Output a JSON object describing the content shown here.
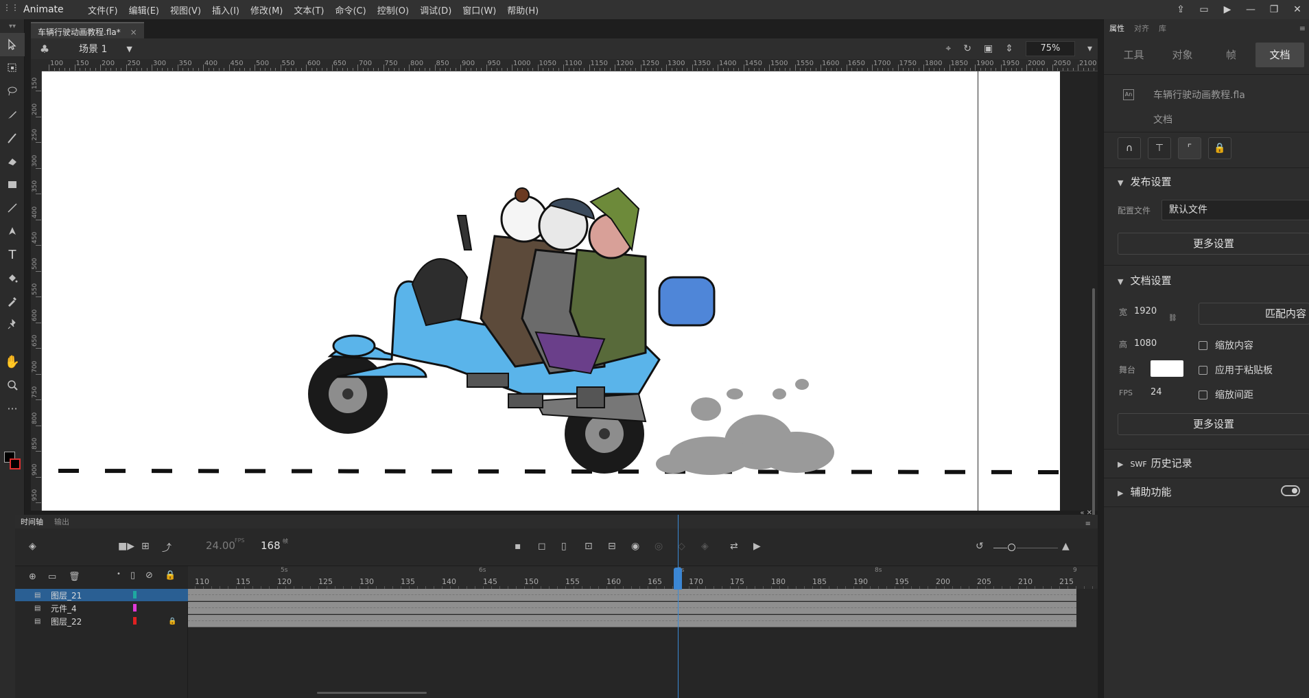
{
  "menubar": {
    "app_name": "Animate",
    "items": [
      "文件(F)",
      "编辑(E)",
      "视图(V)",
      "插入(I)",
      "修改(M)",
      "文本(T)",
      "命令(C)",
      "控制(O)",
      "调试(D)",
      "窗口(W)",
      "帮助(H)"
    ]
  },
  "document": {
    "tab_title": "车辆行驶动画教程.fla*",
    "close_glyph": "×"
  },
  "scene": {
    "label": "场景 1",
    "zoom": "75%"
  },
  "ruler": {
    "h_labels": [
      "100",
      "150",
      "200",
      "250",
      "300",
      "350",
      "400",
      "450",
      "500",
      "550",
      "600",
      "650",
      "700",
      "750",
      "800",
      "850",
      "900",
      "950",
      "1000",
      "1050",
      "1100",
      "1150",
      "1200",
      "1250",
      "1300",
      "1350",
      "1400",
      "1450",
      "1500",
      "1550",
      "1600",
      "1650",
      "1700",
      "1750",
      "1800",
      "1850",
      "1900",
      "1950",
      "2000",
      "2050",
      "2100"
    ],
    "v_labels": [
      "150",
      "200",
      "250",
      "300",
      "350",
      "400",
      "450",
      "500",
      "550",
      "600",
      "650",
      "700",
      "750",
      "800",
      "850",
      "900",
      "950"
    ]
  },
  "timeline": {
    "tabs": [
      "时间轴",
      "输出"
    ],
    "fps": "24.00",
    "fps_unit": "FPS",
    "frame": "168",
    "frame_unit": "帧",
    "sec_labels": [
      "5s",
      "6s",
      "7s",
      "8s",
      "9"
    ],
    "frame_numbers": [
      "110",
      "115",
      "120",
      "125",
      "130",
      "135",
      "140",
      "145",
      "150",
      "155",
      "160",
      "165",
      "170",
      "175",
      "180",
      "185",
      "190",
      "195",
      "200",
      "205",
      "210",
      "215"
    ],
    "layers": [
      {
        "name": "图层_21",
        "color": "#1fa8a0",
        "selected": true,
        "locked": false
      },
      {
        "name": "元件_4",
        "color": "#e03ad8",
        "selected": false,
        "locked": false
      },
      {
        "name": "图层_22",
        "color": "#e02020",
        "selected": false,
        "locked": true
      }
    ]
  },
  "properties": {
    "top_tabs": [
      "属性",
      "对齐",
      "库"
    ],
    "sub_tabs": [
      "工具",
      "对象",
      "帧",
      "文档"
    ],
    "doc_name": "车辆行驶动画教程.fla",
    "doc_type": "文档",
    "publish": {
      "title": "发布设置",
      "profile_label": "配置文件",
      "profile_value": "默认文件",
      "more_settings": "更多设置"
    },
    "doc_settings": {
      "title": "文档设置",
      "width_label": "宽",
      "width_value": "1920",
      "height_label": "高",
      "height_value": "1080",
      "stage_label": "舞台",
      "fps_label": "FPS",
      "fps_value": "24",
      "match_contents": "匹配内容",
      "scale_content": "缩放内容",
      "apply_pasteboard": "应用于粘贴板",
      "scale_spacing": "缩放间距",
      "more_settings": "更多设置"
    },
    "swf_history": "历史记录",
    "swf_prefix": "SWF",
    "accessibility": "辅助功能"
  },
  "colors": {
    "accent": "#3b86d4",
    "stage": "#ffffff",
    "scooter": "#5ab4ea",
    "smoke": "#9a9a9a"
  }
}
